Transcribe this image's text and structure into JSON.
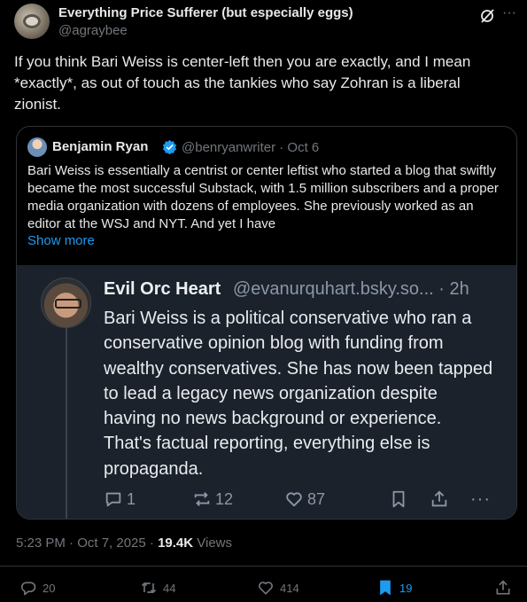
{
  "post": {
    "display_name": "Everything Price Sufferer (but especially eggs)",
    "handle": "@agraybee",
    "text": "If you think Bari Weiss is center-left then you are exactly, and I mean *exactly*, as out of touch as the tankies who say Zohran is a liberal zionist.",
    "timestamp": "5:23 PM · Oct 7, 2025 · ",
    "views_count": "19.4K",
    "views_label": " Views"
  },
  "quote": {
    "name": "Benjamin Ryan",
    "meta": "@benryanwriter · Oct 6",
    "text": "Bari Weiss is essentially a centrist or center leftist who started a blog that swiftly became the most successful Substack, with 1.5 million subscribers and a proper media organization with dozens of employees. She previously worked as an editor at the WSJ and NYT. And yet I have",
    "show_more": "Show more"
  },
  "embed": {
    "name": "Evil Orc Heart",
    "meta": "@evanurquhart.bsky.so... · 2h",
    "text": "Bari Weiss is a political conservative who ran a conservative opinion blog with funding from wealthy conservatives. She has now been tapped to lead a legacy news organization despite having no news background or experience. That's factual reporting, everything else is propaganda.",
    "replies": "1",
    "reposts": "12",
    "likes": "87"
  },
  "actions": {
    "replies": "20",
    "reposts": "44",
    "likes": "414",
    "bookmarks": "19"
  },
  "colors": {
    "accent": "#1d9bf0",
    "muted": "#71767b",
    "background": "#000000",
    "embed_background": "#1c222b"
  },
  "icons": [
    "grok-icon",
    "more-icon",
    "verified-badge-icon",
    "reply-icon",
    "repost-icon",
    "like-icon",
    "bookmark-icon",
    "share-icon"
  ]
}
